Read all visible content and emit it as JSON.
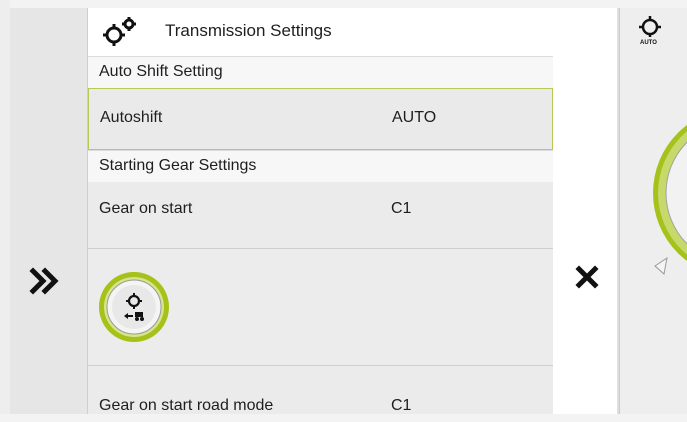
{
  "header": {
    "title": "Transmission Settings",
    "icon": "gears-icon"
  },
  "sections": {
    "auto_shift": "Auto Shift Setting",
    "starting_gear": "Starting Gear Settings"
  },
  "rows": {
    "autoshift": {
      "label": "Autoshift",
      "value": "AUTO"
    },
    "gear_on_start": {
      "label": "Gear on start",
      "value": "C1"
    },
    "gear_on_start_road": {
      "label": "Gear on start road mode",
      "value": "C1"
    }
  },
  "controls": {
    "expand_icon": "double-chevron-right-icon",
    "close_icon": "close-icon",
    "knob_icon": "gear-tractor-icon"
  },
  "right_panel": {
    "badge_text": "AUTO"
  },
  "colors": {
    "accent_green": "#a4c21a",
    "panel_gray": "#eeeeee",
    "text": "#1e1e1e"
  }
}
